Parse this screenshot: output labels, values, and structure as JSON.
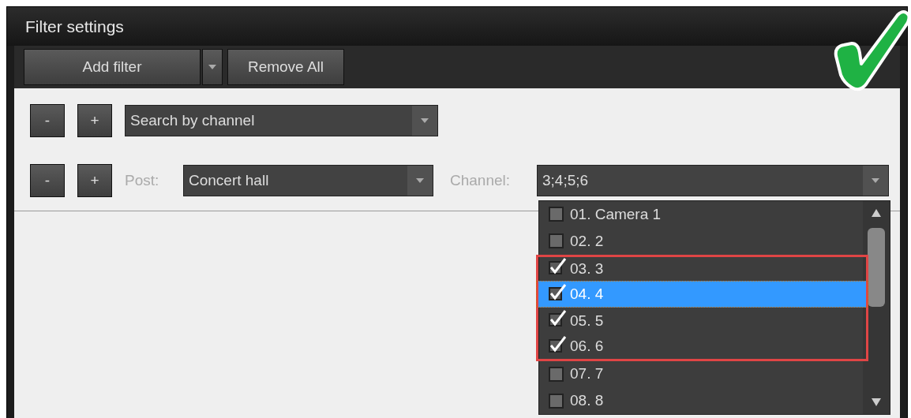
{
  "window": {
    "title": "Filter settings"
  },
  "toolbar": {
    "add_filter": "Add filter",
    "remove_all": "Remove All"
  },
  "filters": [
    {
      "kind": "search",
      "minus": "-",
      "plus": "+",
      "value": "Search by channel"
    },
    {
      "kind": "post",
      "minus": "-",
      "plus": "+",
      "post_label": "Post:",
      "post_value": "Concert hall",
      "channel_label": "Channel:",
      "channel_value": "3;4;5;6"
    }
  ],
  "channel_list": {
    "items": [
      {
        "label": "01. Camera 1",
        "checked": false,
        "selected": false,
        "highlighted": false
      },
      {
        "label": "02. 2",
        "checked": false,
        "selected": false,
        "highlighted": false
      },
      {
        "label": "03. 3",
        "checked": true,
        "selected": false,
        "highlighted": true
      },
      {
        "label": "04. 4",
        "checked": true,
        "selected": true,
        "highlighted": true
      },
      {
        "label": "05. 5",
        "checked": true,
        "selected": false,
        "highlighted": true
      },
      {
        "label": "06. 6",
        "checked": true,
        "selected": false,
        "highlighted": true
      },
      {
        "label": "07. 7",
        "checked": false,
        "selected": false,
        "highlighted": false
      },
      {
        "label": "08. 8",
        "checked": false,
        "selected": false,
        "highlighted": false
      }
    ]
  }
}
